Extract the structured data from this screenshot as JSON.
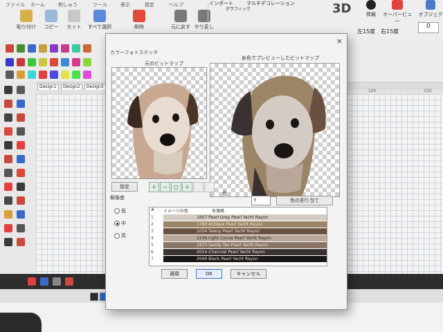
{
  "ribbon": {
    "tabs": [
      "ファイル",
      "ホーム",
      "刺しゅう",
      "ツール",
      "表示",
      "設定",
      "ヘルプ"
    ],
    "buttons": [
      "貼り付け",
      "コピー",
      "カット",
      "すべて選択",
      "削除",
      "元に戻す",
      "やり直し"
    ],
    "import_label": "インポート",
    "graphic_label": "グラフィック",
    "multi_label": "マルチデコレーション",
    "mode_3d": "3D",
    "info_label": "情報",
    "overview_label": "オーバービュー",
    "object_label": "オブジェク",
    "rotate_left": "左15度",
    "rotate_right": "右15度",
    "rotate_value": "0"
  },
  "doc_tabs": [
    "Design1",
    "Design2",
    "Design3"
  ],
  "ruler": {
    "left": "100",
    "right": "150"
  },
  "dialog": {
    "title": "カラーフォトステッチ",
    "close": "×",
    "original_label": "元のビットマップ",
    "preview_label": "糸色でプレビューしたビットマップ",
    "settings_button": "設定",
    "resolution_label": "解像度",
    "radios": [
      {
        "label": "低",
        "selected": false
      },
      {
        "label": "中",
        "selected": true
      },
      {
        "label": "高",
        "selected": false
      }
    ],
    "zoom_buttons": [
      "＋",
      "−",
      "◻",
      "＋"
    ],
    "colors_label": "色",
    "colors_value": "7",
    "reassign_button": "色の割り当て",
    "table_headers": [
      "#",
      "イメージの色",
      "糸価格"
    ],
    "rows": [
      {
        "n": "1",
        "name": "1607 Pearl Grey Pearl Yacht Rayon",
        "color": "#d4ccc4",
        "text": "#222"
      },
      {
        "n": "2",
        "name": "1790 Antique Pearl Yacht Rayon",
        "color": "#9c8466",
        "text": "#f0e8dc"
      },
      {
        "n": "3",
        "name": "1034 Tawny Pearl Yacht Rayon",
        "color": "#6a5040",
        "text": "#f0e8dc"
      },
      {
        "n": "4",
        "name": "2236 Light Cocoa Pearl Yacht Rayon",
        "color": "#b9a89a",
        "text": "#222"
      },
      {
        "n": "5",
        "name": "1875 Sandy Tan Pearl Yacht Rayon",
        "color": "#8a7664",
        "text": "#f0e8dc"
      },
      {
        "n": "6",
        "name": "2014 Charcoal Pearl Yacht Rayon",
        "color": "#3a3230",
        "text": "#f0e8dc"
      },
      {
        "n": "7",
        "name": "2040 Black Pearl Yacht Rayon",
        "color": "#1a1614",
        "text": "#f0e8dc"
      }
    ],
    "apply_button": "適用",
    "ok_button": "OK",
    "cancel_button": "キャンセル"
  },
  "palette_colors": [
    "#2a2a2a",
    "#1a6ac9",
    "#e23a2a",
    "#f2d22a",
    "#2aa84a",
    "#8a3ac9",
    "#f28a2a",
    "#9ad22a",
    "#e23a9a",
    "#2ac9c9",
    "#ffffff",
    "#c92a2a",
    "#2a2ac9",
    "#f2f22a",
    "#2ac92a",
    "#c92ac9",
    "#111111",
    "#e24a8a",
    "#4a8ae2"
  ]
}
